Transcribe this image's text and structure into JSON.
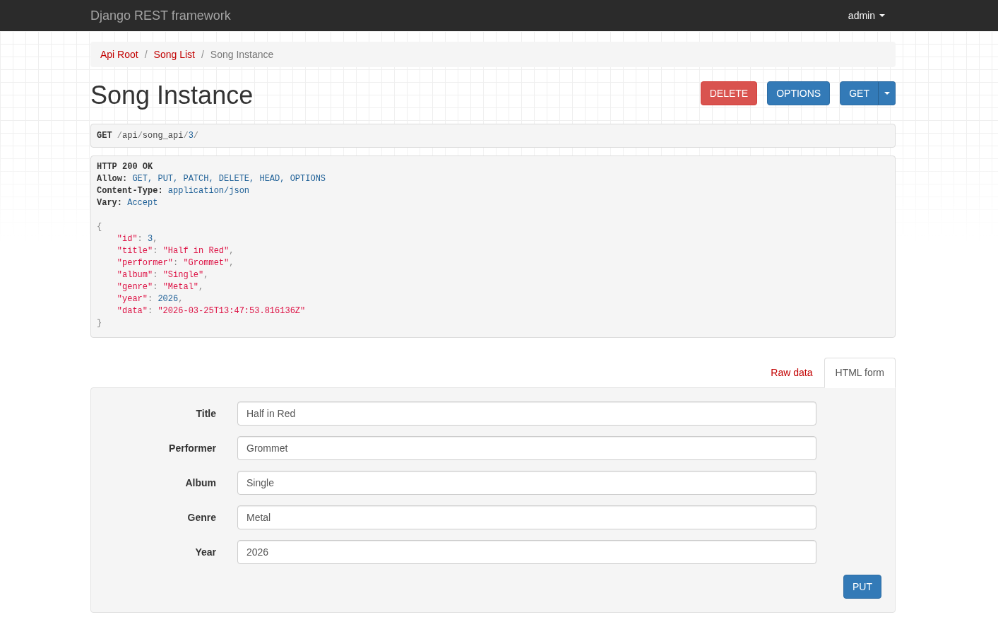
{
  "navbar": {
    "brand": "Django REST framework",
    "user_menu": {
      "label": "admin"
    }
  },
  "breadcrumb": [
    {
      "label": "Api Root",
      "kind": "link"
    },
    {
      "label": "/",
      "kind": "separator"
    },
    {
      "label": "Song List",
      "kind": "link"
    },
    {
      "label": "/",
      "kind": "separator"
    },
    {
      "label": "Song Instance",
      "kind": "current"
    }
  ],
  "page_title": "Song Instance",
  "actions": [
    {
      "label": "DELETE",
      "kind": "danger"
    },
    {
      "label": "OPTIONS",
      "kind": "primary"
    },
    {
      "label": "GET",
      "kind": "split"
    }
  ],
  "request": {
    "method": "GET",
    "path": [
      {
        "text": "/",
        "kind": "punct"
      },
      {
        "text": "api",
        "kind": "plain"
      },
      {
        "text": "/",
        "kind": "punct"
      },
      {
        "text": "song_api",
        "kind": "plain"
      },
      {
        "text": "/",
        "kind": "punct"
      },
      {
        "text": "3",
        "kind": "number"
      },
      {
        "text": "/",
        "kind": "punct"
      }
    ]
  },
  "response": {
    "status": "HTTP 200 OK",
    "headers": [
      {
        "name": "Allow:",
        "value": "GET, PUT, PATCH, DELETE, HEAD, OPTIONS"
      },
      {
        "name": "Content-Type:",
        "value": "application/json"
      },
      {
        "name": "Vary:",
        "value": "Accept"
      }
    ],
    "body": {
      "open": "{",
      "lines": [
        {
          "tokens": [
            {
              "text": "\"id\"",
              "kind": "string"
            },
            {
              "text": ": ",
              "kind": "punct"
            },
            {
              "text": "3",
              "kind": "number"
            },
            {
              "text": ",",
              "kind": "punct"
            }
          ]
        },
        {
          "tokens": [
            {
              "text": "\"title\"",
              "kind": "string"
            },
            {
              "text": ": ",
              "kind": "punct"
            },
            {
              "text": "\"Half in Red\"",
              "kind": "string"
            },
            {
              "text": ",",
              "kind": "punct"
            }
          ]
        },
        {
          "tokens": [
            {
              "text": "\"performer\"",
              "kind": "string"
            },
            {
              "text": ": ",
              "kind": "punct"
            },
            {
              "text": "\"Grommet\"",
              "kind": "string"
            },
            {
              "text": ",",
              "kind": "punct"
            }
          ]
        },
        {
          "tokens": [
            {
              "text": "\"album\"",
              "kind": "string"
            },
            {
              "text": ": ",
              "kind": "punct"
            },
            {
              "text": "\"Single\"",
              "kind": "string"
            },
            {
              "text": ",",
              "kind": "punct"
            }
          ]
        },
        {
          "tokens": [
            {
              "text": "\"genre\"",
              "kind": "string"
            },
            {
              "text": ": ",
              "kind": "punct"
            },
            {
              "text": "\"Metal\"",
              "kind": "string"
            },
            {
              "text": ",",
              "kind": "punct"
            }
          ]
        },
        {
          "tokens": [
            {
              "text": "\"year\"",
              "kind": "string"
            },
            {
              "text": ": ",
              "kind": "punct"
            },
            {
              "text": "2026",
              "kind": "number"
            },
            {
              "text": ",",
              "kind": "punct"
            }
          ]
        },
        {
          "tokens": [
            {
              "text": "\"data\"",
              "kind": "string"
            },
            {
              "text": ": ",
              "kind": "punct"
            },
            {
              "text": "\"2026-03-25T13:47:53.816136Z\"",
              "kind": "string"
            }
          ]
        }
      ],
      "close": "}"
    }
  },
  "tabs": [
    {
      "label": "Raw data",
      "selected": false
    },
    {
      "label": "HTML form",
      "selected": true
    }
  ],
  "form": {
    "fields": [
      {
        "label": "Title",
        "value": "Half in Red"
      },
      {
        "label": "Performer",
        "value": "Grommet"
      },
      {
        "label": "Album",
        "value": "Single"
      },
      {
        "label": "Genre",
        "value": "Metal"
      },
      {
        "label": "Year",
        "value": "2026"
      }
    ],
    "submit": "PUT"
  }
}
